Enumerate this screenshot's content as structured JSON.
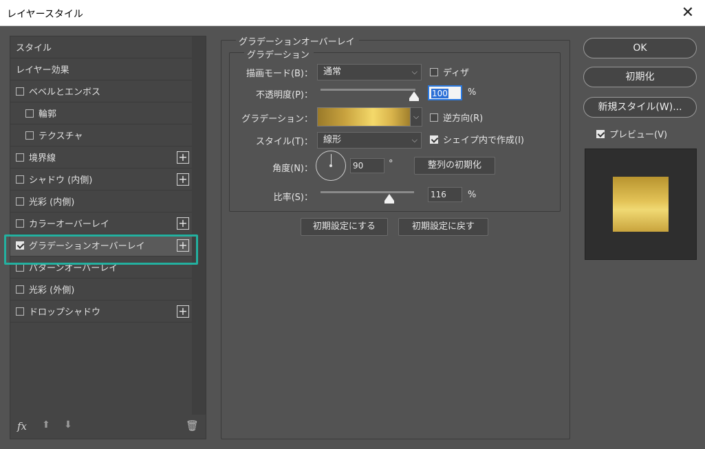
{
  "window": {
    "title": "レイヤースタイル",
    "close_glyph": "✕"
  },
  "left_panel": {
    "items": [
      {
        "label": "スタイル"
      },
      {
        "label": "レイヤー効果"
      },
      {
        "label": "ベベルとエンボス",
        "checked": false
      },
      {
        "label": "輪郭",
        "checked": false
      },
      {
        "label": "テクスチャ",
        "checked": false
      },
      {
        "label": "境界線",
        "checked": false
      },
      {
        "label": "シャドウ (内側)",
        "checked": false
      },
      {
        "label": "光彩 (内側)",
        "checked": false
      },
      {
        "label": "カラーオーバーレイ",
        "checked": false
      },
      {
        "label": "グラデーションオーバーレイ",
        "checked": true,
        "selected": true
      },
      {
        "label": "パターンオーバーレイ",
        "checked": false
      },
      {
        "label": "光彩 (外側)",
        "checked": false
      },
      {
        "label": "ドロップシャドウ",
        "checked": false
      }
    ],
    "plus_glyph": "+",
    "footer": {
      "fx": "fx",
      "up": "⬆",
      "down": "⬇",
      "trash": "🗑"
    }
  },
  "section": {
    "title": "グラデーションオーバーレイ",
    "subtitle": "グラデーション",
    "blend_mode": {
      "label": "描画モード(B)：",
      "value": "通常"
    },
    "dither": {
      "label": "ディザ",
      "checked": false
    },
    "opacity": {
      "label": "不透明度(P)：",
      "value": "100",
      "unit": "%",
      "level": 100
    },
    "gradient": {
      "label": "グラデーション："
    },
    "reverse": {
      "label": "逆方向(R)",
      "checked": false
    },
    "style": {
      "label": "スタイル(T)：",
      "value": "線形"
    },
    "align_with_layer": {
      "label": "シェイプ内で作成(I)",
      "checked": true
    },
    "angle": {
      "label": "角度(N)：",
      "value": "90",
      "unit": "°",
      "reset_button": "整列の初期化"
    },
    "scale": {
      "label": "比率(S)：",
      "value": "116",
      "unit": "%",
      "level": 116
    },
    "make_default": "初期設定にする",
    "reset_default": "初期設定に戻す",
    "caret": "⌵"
  },
  "right_panel": {
    "ok": "OK",
    "reset": "初期化",
    "new_style": "新規スタイル(W)...",
    "preview": {
      "label": "プレビュー(V)",
      "checked": true
    }
  },
  "colors": {
    "highlight": "#23b1a0",
    "gold_light": "#f4d96a",
    "gold_dark": "#9a7a2a"
  }
}
